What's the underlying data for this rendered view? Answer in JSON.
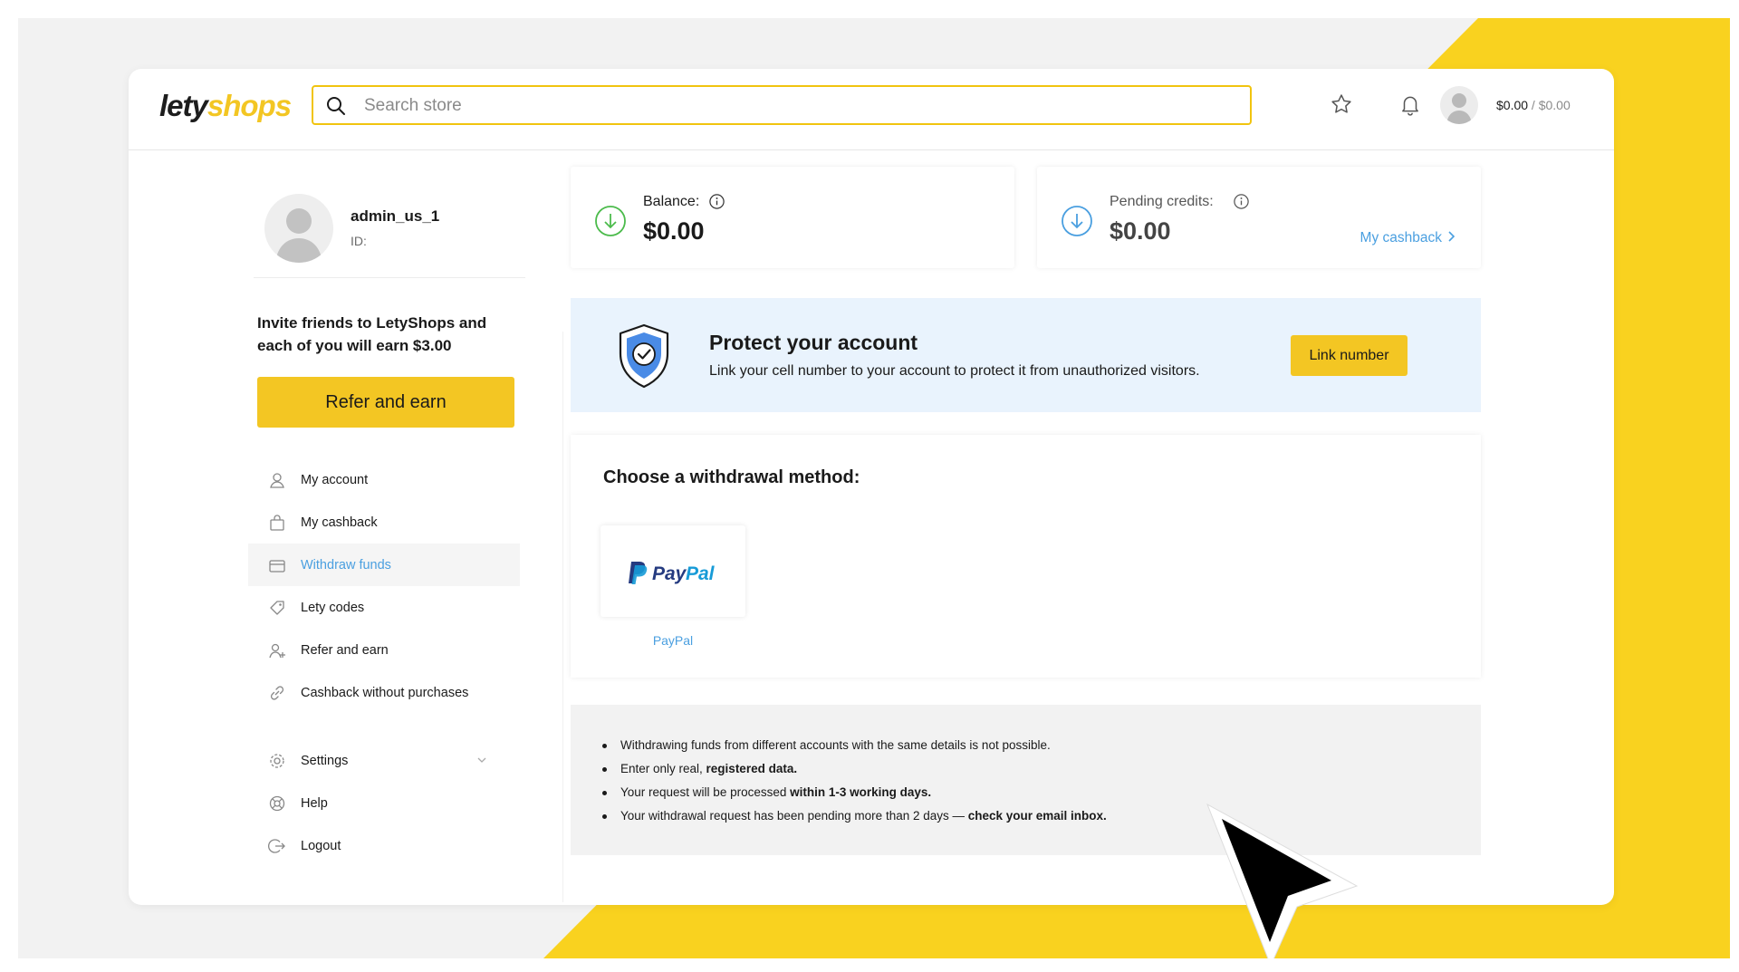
{
  "brand": {
    "part1": "lety",
    "part2": "shops",
    "accent_color": "#F3C623",
    "link_color": "#4A9FE0"
  },
  "header": {
    "search_placeholder": "Search store",
    "balance_main": "$0.00",
    "balance_separator": " / ",
    "balance_pending": "$0.00",
    "icons": [
      "search-icon",
      "star-icon",
      "bell-icon",
      "avatar-icon"
    ]
  },
  "profile": {
    "username": "admin_us_1",
    "id_label": "ID:"
  },
  "referral": {
    "invite_text": "Invite friends to LetyShops and each of you will earn $3.00",
    "button_label": "Refer and earn"
  },
  "sidebar": {
    "items": [
      {
        "label": "My account",
        "icon": "user-icon",
        "active": false
      },
      {
        "label": "My cashback",
        "icon": "bag-icon",
        "active": false
      },
      {
        "label": "Withdraw funds",
        "icon": "wallet-icon",
        "active": true
      },
      {
        "label": "Lety codes",
        "icon": "tag-icon",
        "active": false
      },
      {
        "label": "Refer and earn",
        "icon": "add-user-icon",
        "active": false
      },
      {
        "label": "Cashback without purchases",
        "icon": "link-icon",
        "active": false
      },
      {
        "label": "Settings",
        "icon": "gear-icon",
        "active": false
      },
      {
        "label": "Help",
        "icon": "lifebuoy-icon",
        "active": false
      },
      {
        "label": "Logout",
        "icon": "logout-icon",
        "active": false
      }
    ]
  },
  "stats": {
    "balance": {
      "label": "Balance:",
      "value": "$0.00"
    },
    "pending": {
      "label": "Pending credits:",
      "value": "$0.00",
      "link": "My cashback"
    }
  },
  "protect": {
    "title": "Protect your account",
    "text": "Link your cell number to your account to protect it from unauthorized visitors.",
    "button_label": "Link number"
  },
  "withdraw": {
    "title": "Choose a withdrawal method:",
    "methods": [
      {
        "name": "PayPal",
        "caption": "PayPal"
      }
    ]
  },
  "notes": [
    {
      "text": "Withdrawing funds from different accounts with the same details is not possible.",
      "bold": ""
    },
    {
      "text": "Enter only real, ",
      "bold": "registered data."
    },
    {
      "text": "Your request will be processed ",
      "bold": "within 1-3 working days."
    },
    {
      "text": "Your withdrawal request has been pending more than 2 days — ",
      "bold": "check your email inbox."
    }
  ]
}
